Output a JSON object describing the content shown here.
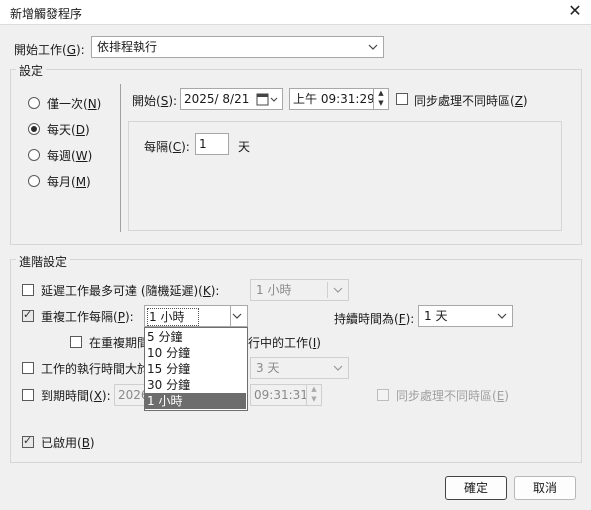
{
  "window": {
    "title": "新增觸發程序",
    "close_glyph": "✕"
  },
  "begin_task": {
    "label": "開始工作(",
    "key": "G",
    "label_end": "):",
    "value": "依排程執行"
  },
  "settings": {
    "group_title": "設定",
    "radios": [
      {
        "label": "僅一次(",
        "key": "N",
        "end": ")",
        "checked": false
      },
      {
        "label": "每天(",
        "key": "D",
        "end": ")",
        "checked": true
      },
      {
        "label": "每週(",
        "key": "W",
        "end": ")",
        "checked": false
      },
      {
        "label": "每月(",
        "key": "M",
        "end": ")",
        "checked": false
      }
    ],
    "start_label": "開始(",
    "start_key": "S",
    "start_label_end": "):",
    "start_date": "2025/  8/21",
    "start_time": "上午 09:31:29",
    "sync_tz_label": "同步處理不同時區(",
    "sync_tz_key": "Z",
    "sync_tz_end": ")",
    "recur_label": "每隔(",
    "recur_key": "C",
    "recur_end": "):",
    "recur_value": "1",
    "recur_unit": "天"
  },
  "advanced": {
    "group_title": "進階設定",
    "delay_label": "延遲工作最多可達 (隨機延遲)(",
    "delay_key": "K",
    "delay_end": "):",
    "delay_value": "1 小時",
    "repeat_label": "重複工作每隔(",
    "repeat_key": "P",
    "repeat_end": "):",
    "repeat_value": "1 小時",
    "duration_label": "持續時間為(",
    "duration_key": "F",
    "duration_end": "):",
    "duration_value": "1 天",
    "stop_running_prefix": "在重複期間",
    "stop_running_suffix": "行中的工作(",
    "stop_running_key": "I",
    "stop_running_end": ")",
    "stop_longer_label": "工作的執行時間大於",
    "stop_longer_value": "3 天",
    "expire_label": "到期時間(",
    "expire_key": "X",
    "expire_end": "):",
    "expire_date": "2026",
    "expire_time": "09:31:31",
    "expire_sync_label": "同步處理不同時區(",
    "expire_sync_key": "E",
    "expire_sync_end": ")",
    "enabled_label": "已啟用(",
    "enabled_key": "B",
    "enabled_end": ")",
    "repeat_options": [
      "5 分鐘",
      "10 分鐘",
      "15 分鐘",
      "30 分鐘",
      "1 小時"
    ],
    "repeat_selected_index": 4
  },
  "buttons": {
    "ok": "確定",
    "cancel": "取消"
  }
}
